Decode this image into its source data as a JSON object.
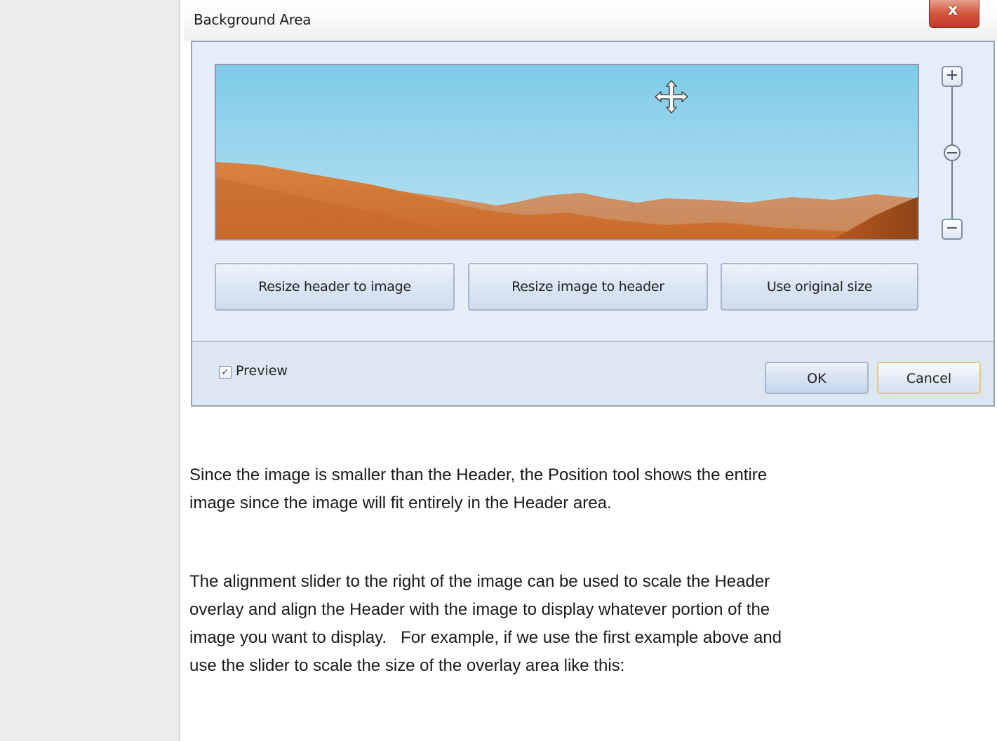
{
  "dialog": {
    "title": "Background Area",
    "close_label": "x",
    "buttons": {
      "resize_header": "Resize header to image",
      "resize_image": "Resize image to header",
      "original_size": "Use original size",
      "ok": "OK",
      "cancel": "Cancel"
    },
    "zoom": {
      "plus_label": "+",
      "minus_label": "−",
      "level": 0.5
    },
    "preview": {
      "label": "Preview",
      "checked": true
    },
    "image_icon": "move-cursor-icon"
  },
  "article": {
    "paragraph_1": "Since the image is smaller than the Header, the Position tool shows the entire\nimage since the image will fit entirely in the Header area.",
    "paragraph_2": "The alignment slider to the right of the image can be used to scale the Header\noverlay and align the Header with the image to display whatever portion of the\nimage you want to display.   For example, if we use the first example above and\nuse the slider to scale the size of the overlay area like this:"
  },
  "colors": {
    "sidebar": "#ececec",
    "dialog_body": "#e4edf8",
    "close_button": "#c0392b",
    "sky_top": "#7ecbe8",
    "sand": "#d27a3a"
  }
}
